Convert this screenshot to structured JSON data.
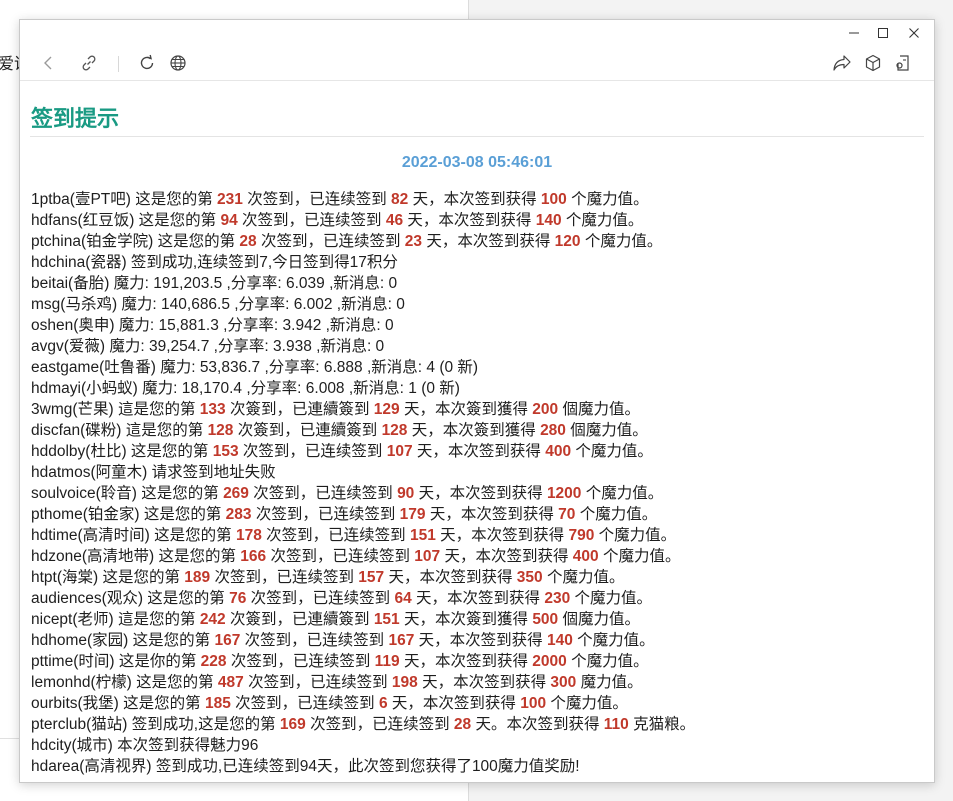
{
  "background": {
    "partial_text": "爱说"
  },
  "window_controls": {
    "minimize_glyph": "—",
    "maximize_glyph": "☐",
    "close_glyph": "✕"
  },
  "toolbar": {
    "back_icon": "back-arrow-icon",
    "link_icon": "link-icon",
    "reload_icon": "reload-icon",
    "globe_icon": "globe-icon",
    "share_icon": "share-icon",
    "cube_icon": "cube-icon",
    "extension_icon": "extension-icon"
  },
  "page": {
    "title": "签到提示",
    "timestamp": "2022-03-08 05:46:01"
  },
  "colors": {
    "title": "#199a83",
    "timestamp": "#5a9fd6",
    "highlight": "#c0392b"
  },
  "lines": [
    {
      "a": "1ptba(壹PT吧) 这是您的第 ",
      "n1": "231",
      "b": " 次签到，已连续签到 ",
      "n2": "82",
      "c": " 天，本次签到获得 ",
      "n3": "100",
      "d": " 个魔力值。"
    },
    {
      "a": "hdfans(红豆饭) 这是您的第 ",
      "n1": "94",
      "b": " 次签到，已连续签到 ",
      "n2": "46",
      "c": " 天，本次签到获得 ",
      "n3": "140",
      "d": " 个魔力值。"
    },
    {
      "a": "ptchina(铂金学院) 这是您的第 ",
      "n1": "28",
      "b": " 次签到，已连续签到 ",
      "n2": "23",
      "c": " 天，本次签到获得 ",
      "n3": "120",
      "d": " 个魔力值。"
    },
    {
      "a": "hdchina(瓷器) 签到成功,连续签到7,今日签到得17积分"
    },
    {
      "a": "beitai(备胎) 魔力: 191,203.5 ,分享率: 6.039 ,新消息: 0"
    },
    {
      "a": "msg(马杀鸡) 魔力: 140,686.5 ,分享率: 6.002 ,新消息: 0"
    },
    {
      "a": "oshen(奥申) 魔力: 15,881.3 ,分享率: 3.942 ,新消息: 0"
    },
    {
      "a": "avgv(爱薇) 魔力: 39,254.7 ,分享率: 3.938 ,新消息: 0"
    },
    {
      "a": "eastgame(吐鲁番) 魔力: 53,836.7 ,分享率: 6.888 ,新消息: 4 (0 新)"
    },
    {
      "a": "hdmayi(小蚂蚁) 魔力: 18,170.4 ,分享率: 6.008 ,新消息: 1 (0 新)"
    },
    {
      "a": "3wmg(芒果) 這是您的第 ",
      "n1": "133",
      "b": " 次簽到，已連續簽到 ",
      "n2": "129",
      "c": " 天，本次簽到獲得 ",
      "n3": "200",
      "d": " 個魔力值。"
    },
    {
      "a": "discfan(碟粉) 這是您的第 ",
      "n1": "128",
      "b": " 次簽到，已連續簽到 ",
      "n2": "128",
      "c": " 天，本次簽到獲得 ",
      "n3": "280",
      "d": " 個魔力值。"
    },
    {
      "a": "hddolby(杜比) 这是您的第 ",
      "n1": "153",
      "b": " 次签到，已连续签到 ",
      "n2": "107",
      "c": " 天，本次签到获得 ",
      "n3": "400",
      "d": " 个魔力值。"
    },
    {
      "a": "hdatmos(阿童木) 请求签到地址失败"
    },
    {
      "a": "soulvoice(聆音) 这是您的第 ",
      "n1": "269",
      "b": " 次签到，已连续签到 ",
      "n2": "90",
      "c": " 天，本次签到获得 ",
      "n3": "1200",
      "d": " 个魔力值。"
    },
    {
      "a": "pthome(铂金家) 这是您的第 ",
      "n1": "283",
      "b": " 次签到，已连续签到 ",
      "n2": "179",
      "c": " 天，本次签到获得 ",
      "n3": "70",
      "d": " 个魔力值。"
    },
    {
      "a": "hdtime(高清时间) 这是您的第 ",
      "n1": "178",
      "b": " 次签到，已连续签到 ",
      "n2": "151",
      "c": " 天，本次签到获得 ",
      "n3": "790",
      "d": " 个魔力值。"
    },
    {
      "a": "hdzone(高清地带) 这是您的第 ",
      "n1": "166",
      "b": " 次签到，已连续签到 ",
      "n2": "107",
      "c": " 天，本次签到获得 ",
      "n3": "400",
      "d": " 个魔力值。"
    },
    {
      "a": "htpt(海棠) 这是您的第 ",
      "n1": "189",
      "b": " 次签到，已连续签到 ",
      "n2": "157",
      "c": " 天，本次签到获得 ",
      "n3": "350",
      "d": " 个魔力值。"
    },
    {
      "a": "audiences(观众) 这是您的第 ",
      "n1": "76",
      "b": " 次签到，已连续签到 ",
      "n2": "64",
      "c": " 天，本次签到获得 ",
      "n3": "230",
      "d": " 个魔力值。"
    },
    {
      "a": "nicept(老师) 這是您的第 ",
      "n1": "242",
      "b": " 次簽到，已連續簽到 ",
      "n2": "151",
      "c": " 天，本次簽到獲得 ",
      "n3": "500",
      "d": " 個魔力值。"
    },
    {
      "a": "hdhome(家园) 这是您的第 ",
      "n1": "167",
      "b": " 次签到，已连续签到 ",
      "n2": "167",
      "c": " 天，本次签到获得 ",
      "n3": "140",
      "d": " 个魔力值。"
    },
    {
      "a": "pttime(时间) 这是你的第 ",
      "n1": "228",
      "b": " 次签到，已连续签到 ",
      "n2": "119",
      "c": " 天，本次签到获得 ",
      "n3": "2000",
      "d": " 个魔力值。"
    },
    {
      "a": "lemonhd(柠檬) 这是您的第 ",
      "n1": "487",
      "b": " 次签到，已连续签到 ",
      "n2": "198",
      "c": " 天，本次签到获得 ",
      "n3": "300",
      "d": " 魔力值。"
    },
    {
      "a": "ourbits(我堡) 这是您的第 ",
      "n1": "185",
      "b": " 次签到，已连续签到 ",
      "n2": "6",
      "c": " 天，本次签到获得 ",
      "n3": "100",
      "d": " 个魔力值。"
    },
    {
      "a": "pterclub(猫站) 签到成功,这是您的第 ",
      "n1": "169",
      "b": " 次签到，已连续签到 ",
      "n2": "28",
      "c": " 天。本次签到获得 ",
      "n3": "110",
      "d": " 克猫粮。"
    },
    {
      "a": "hdcity(城市) 本次签到获得魅力96"
    },
    {
      "a": "hdarea(高清视界) 签到成功,已连续签到94天，此次签到您获得了100魔力值奖励!"
    }
  ]
}
